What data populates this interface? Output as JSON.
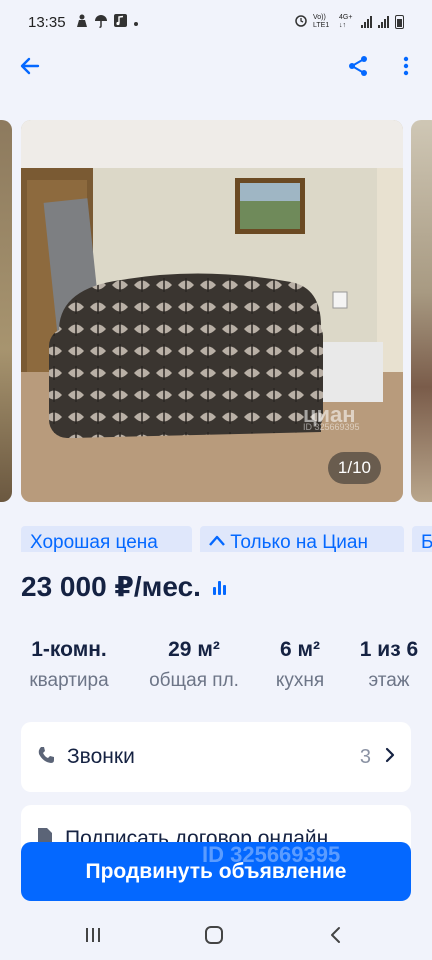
{
  "status_bar": {
    "time": "13:35",
    "left_icons": [
      "person-icon",
      "umbrella-icon",
      "music-icon",
      "dot-icon"
    ],
    "network_label_1": "Vo)) LTE1",
    "network_label_2": "4G+ ↓↑"
  },
  "app_bar": {
    "back_icon": "back-arrow-icon",
    "share_icon": "share-icon",
    "more_icon": "more-vertical-icon"
  },
  "gallery": {
    "counter": "1/10",
    "watermark": "циан",
    "watermark_id": "ID 325669395"
  },
  "tags": [
    {
      "label": "Хорошая цена"
    },
    {
      "label": "Только на Циан"
    },
    {
      "label": "Б"
    }
  ],
  "price": {
    "value": "23 000 ₽/мес."
  },
  "facts": [
    {
      "value": "1-комн.",
      "label": "квартира"
    },
    {
      "value": "29 м²",
      "label": "общая пл."
    },
    {
      "value": "6 м²",
      "label": "кухня"
    },
    {
      "value": "1 из 6",
      "label": "этаж"
    }
  ],
  "calls": {
    "label": "Звонки",
    "count": "3"
  },
  "sign_contract": {
    "label": "Подписать договор онлайн"
  },
  "promote_button": {
    "label": "Продвинуть объявление"
  },
  "overlay_watermark": "ID 325669395",
  "colors": {
    "accent": "#0468ff",
    "background": "#f1f3fb",
    "text": "#152242",
    "muted": "#6d7587",
    "tag_bg": "#dfe7fb"
  }
}
